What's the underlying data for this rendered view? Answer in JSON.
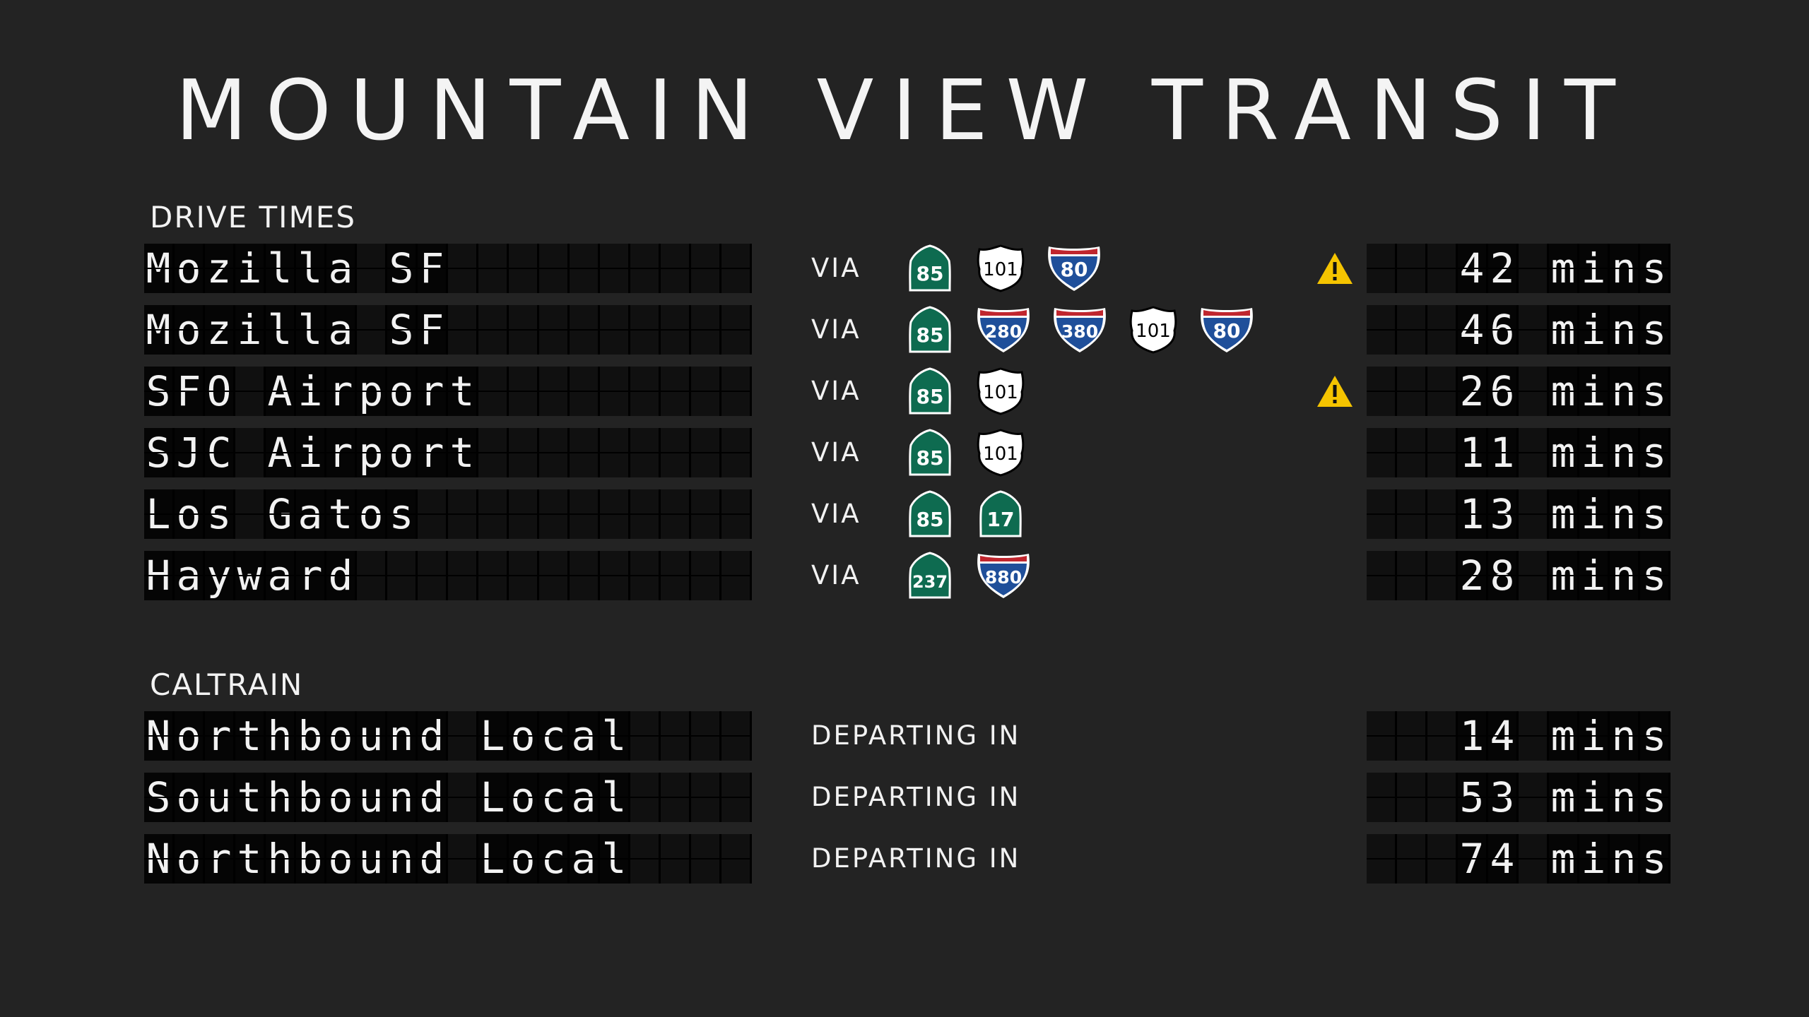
{
  "title": "MOUNTAIN VIEW TRANSIT",
  "sections": {
    "drive": "DRIVE TIMES",
    "caltrain": "CALTRAIN"
  },
  "drive_rows": [
    {
      "name": "Mozilla SF",
      "via": "VIA",
      "warning": true,
      "time": "42 mins",
      "routes": [
        {
          "type": "state",
          "num": "85"
        },
        {
          "type": "us",
          "num": "101"
        },
        {
          "type": "interstate",
          "num": "80"
        }
      ]
    },
    {
      "name": "Mozilla SF",
      "via": "VIA",
      "warning": false,
      "time": "46 mins",
      "routes": [
        {
          "type": "state",
          "num": "85"
        },
        {
          "type": "interstate",
          "num": "280"
        },
        {
          "type": "interstate",
          "num": "380"
        },
        {
          "type": "us",
          "num": "101"
        },
        {
          "type": "interstate",
          "num": "80"
        }
      ]
    },
    {
      "name": "SFO Airport",
      "via": "VIA",
      "warning": true,
      "time": "26 mins",
      "routes": [
        {
          "type": "state",
          "num": "85"
        },
        {
          "type": "us",
          "num": "101"
        }
      ]
    },
    {
      "name": "SJC Airport",
      "via": "VIA",
      "warning": false,
      "time": "11 mins",
      "routes": [
        {
          "type": "state",
          "num": "85"
        },
        {
          "type": "us",
          "num": "101"
        }
      ]
    },
    {
      "name": "Los Gatos",
      "via": "VIA",
      "warning": false,
      "time": "13 mins",
      "routes": [
        {
          "type": "state",
          "num": "85"
        },
        {
          "type": "state",
          "num": "17"
        }
      ]
    },
    {
      "name": "Hayward",
      "via": "VIA",
      "warning": false,
      "time": "28 mins",
      "routes": [
        {
          "type": "state",
          "num": "237"
        },
        {
          "type": "interstate",
          "num": "880"
        }
      ]
    }
  ],
  "train_rows": [
    {
      "name": "Northbound Local",
      "via": "DEPARTING IN",
      "time": "14 mins"
    },
    {
      "name": "Southbound Local",
      "via": "DEPARTING IN",
      "time": "53 mins"
    },
    {
      "name": "Northbound Local",
      "via": "DEPARTING IN",
      "time": "74 mins"
    }
  ],
  "colors": {
    "background": "#232323",
    "state_green": "#0e6b50",
    "interstate_blue": "#1f4f9a",
    "interstate_red": "#c0262e",
    "warning_yellow": "#f5c400"
  },
  "icons": {
    "warning": "warning-icon",
    "state": "state-route-shield-icon",
    "us": "us-route-shield-icon",
    "interstate": "interstate-shield-icon"
  }
}
